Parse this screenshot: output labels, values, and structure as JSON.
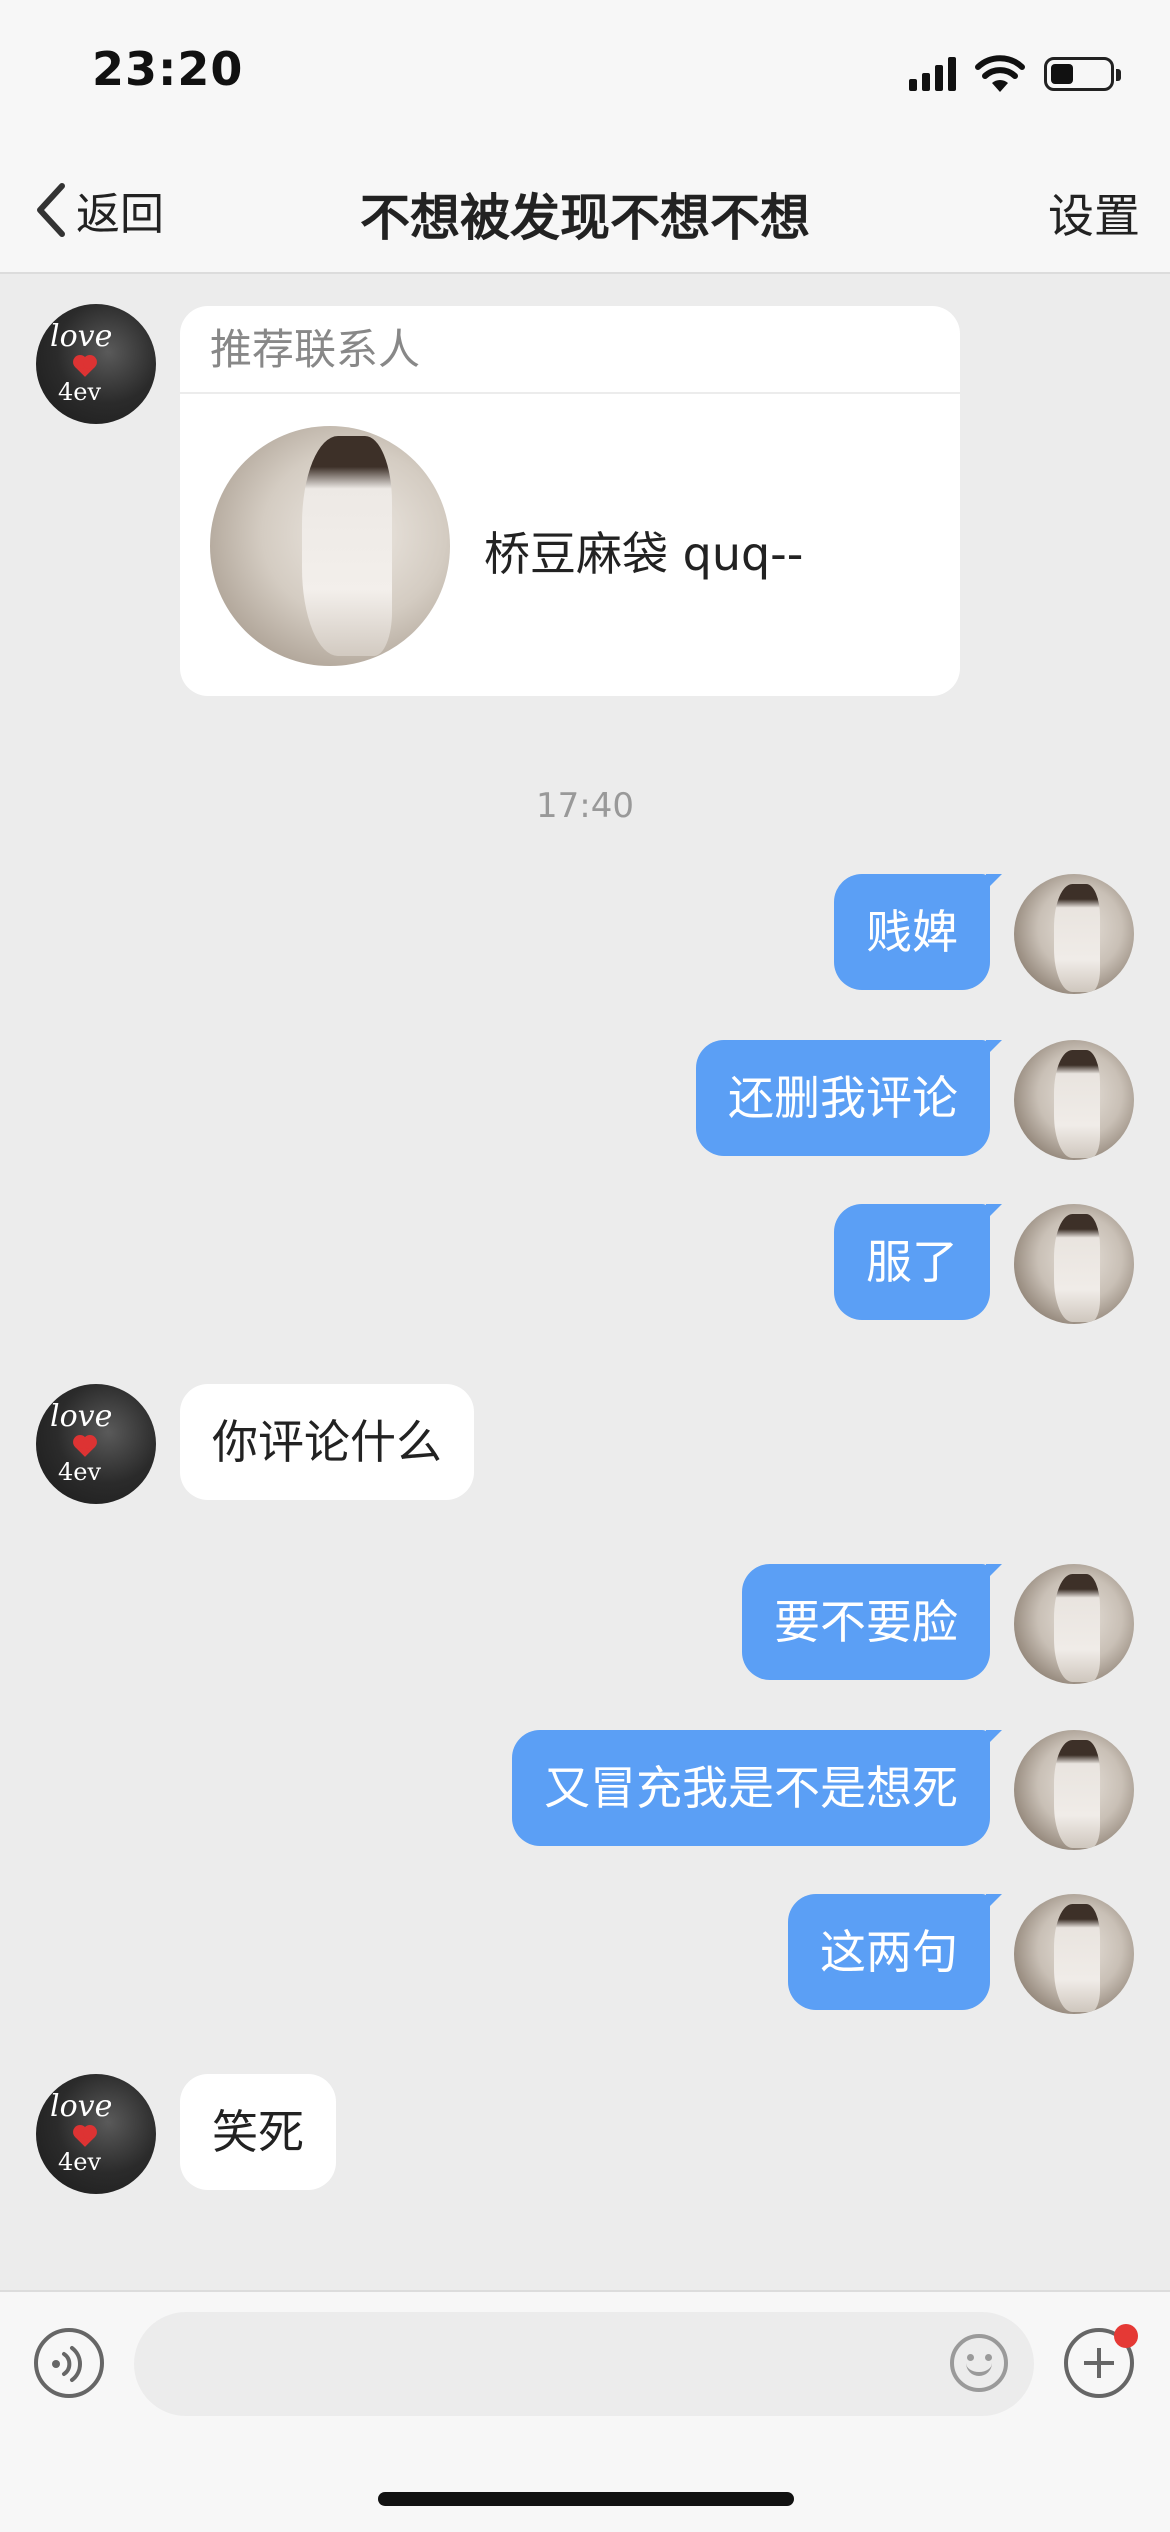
{
  "status_bar": {
    "time": "23:20"
  },
  "nav": {
    "back_label": "返回",
    "title": "不想被发现不想不想",
    "settings_label": "设置"
  },
  "contact_card": {
    "header": "推荐联系人",
    "name": "桥豆麻袋 quq--"
  },
  "timestamp": "17:40",
  "messages": [
    {
      "side": "out",
      "text": "贱婢"
    },
    {
      "side": "out",
      "text": "还删我评论"
    },
    {
      "side": "out",
      "text": "服了"
    },
    {
      "side": "in",
      "text": "你评论什么"
    },
    {
      "side": "out",
      "text": "要不要脸"
    },
    {
      "side": "out",
      "text": "又冒充我是不是想死"
    },
    {
      "side": "out",
      "text": "这两句"
    },
    {
      "side": "in",
      "text": "笑死"
    }
  ],
  "avatar_left": {
    "line1": "love",
    "line2": "4ev"
  },
  "input": {
    "placeholder": ""
  },
  "colors": {
    "bubble_out": "#5b9ff5",
    "bubble_in": "#ffffff",
    "background": "#ececec",
    "badge": "#e53935"
  }
}
